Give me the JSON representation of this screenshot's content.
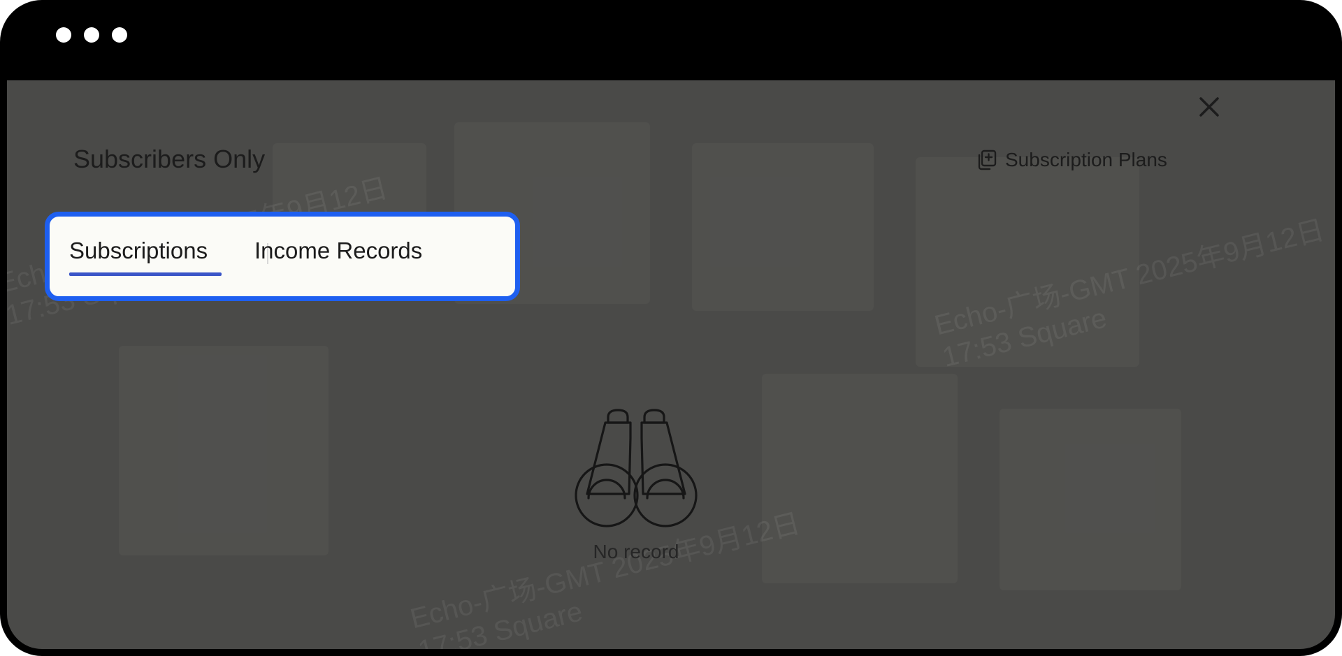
{
  "window": {
    "controls": [
      "window-dot",
      "window-dot",
      "window-dot"
    ]
  },
  "dialog": {
    "title": "Subscribers Only",
    "close_icon": "close-icon",
    "plans_link": {
      "icon": "subscription-plans-icon",
      "label": "Subscription Plans"
    },
    "tabs": [
      {
        "label": "Subscriptions",
        "active": true
      },
      {
        "label": "Income Records",
        "active": false
      }
    ],
    "empty_state": {
      "icon": "binoculars-icon",
      "text": "No record"
    },
    "watermark": {
      "line1": "Echo-广场-GMT 2025年9月12日",
      "line2": "17:53 Square"
    }
  },
  "colors": {
    "overlay": "#4a4a48",
    "highlight": "#1e5ff0",
    "tab_underline": "#3a55c8",
    "text": "#1c1c1c"
  }
}
